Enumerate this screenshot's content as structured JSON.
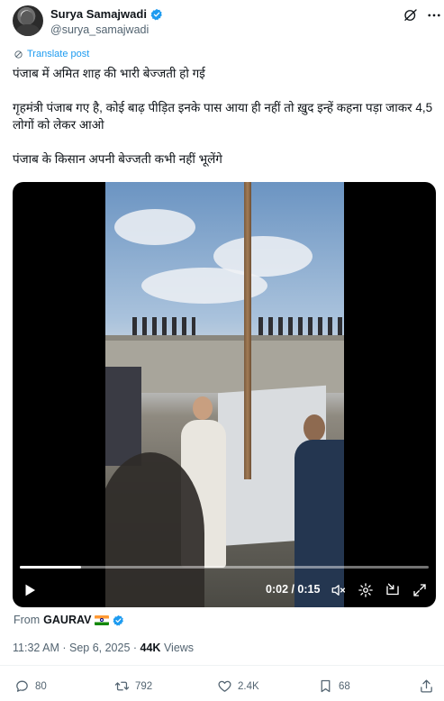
{
  "author": {
    "display_name": "Surya Samajwadi",
    "handle": "@surya_samajwadi",
    "verified_icon": "verified-badge-icon"
  },
  "translate_label": "Translate post",
  "post": {
    "line1": "पंजाब में अमित शाह की भारी बेज्जती हो गई",
    "line2": "गृहमंत्री पंजाब गए है, कोई बाढ़ पीड़ित इनके पास आया ही नहीं तो ख़ुद इन्हें कहना पड़ा जाकर 4,5 लोगों को लेकर आओ",
    "line3": "पंजाब के किसान अपनी बेज्जती कभी नहीं भूलेंगे"
  },
  "video": {
    "time_display": "0:02 / 0:15",
    "progress": 0.15
  },
  "attribution": {
    "prefix": "From",
    "source": "GAURAV"
  },
  "meta": {
    "timestamp": "11:32 AM · Sep 6, 2025 · ",
    "views_count": "44K",
    "views_label": " Views"
  },
  "actions": {
    "replies": "80",
    "reposts": "792",
    "likes": "2.4K",
    "bookmarks": "68"
  },
  "colors": {
    "accent": "#1d9bf0",
    "text": "#0f1419",
    "muted": "#536471"
  }
}
